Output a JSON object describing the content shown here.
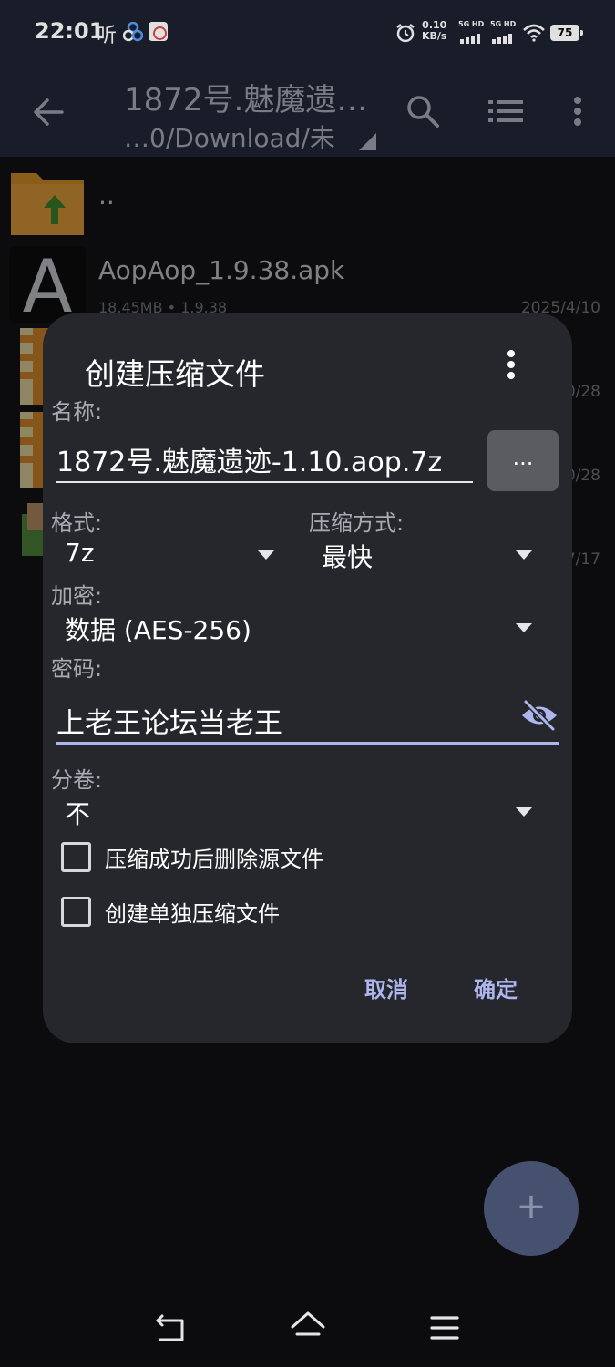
{
  "status_bar": {
    "time": "22:01",
    "listen": "听",
    "net_speed_value": "0.10",
    "net_speed_unit": "KB/s",
    "sim1_label": "5G HD",
    "sim2_label": "5G HD",
    "battery": "75"
  },
  "toolbar": {
    "title": "1872号.魅魔遗…",
    "path": "…0/Download/未"
  },
  "files": [
    {
      "name": "..",
      "meta": "",
      "date": ""
    },
    {
      "name": "AopAop_1.9.38.apk",
      "meta": "18.45MB  • 1.9.38",
      "date": "2025/4/10"
    },
    {
      "name": "",
      "meta": "",
      "date": "0/28"
    },
    {
      "name": "",
      "meta": "",
      "date": "0/28"
    },
    {
      "name": "",
      "meta": "",
      "date": "7/17"
    }
  ],
  "dialog": {
    "title": "创建压缩文件",
    "name_label": "名称:",
    "name_value": "1872号.魅魔遗迹-1.10.aop.7z",
    "browse_label": "...",
    "format_label": "格式:",
    "format_value": "7z",
    "method_label": "压缩方式:",
    "method_value": "最快",
    "encrypt_label": "加密:",
    "encrypt_value": "数据 (AES-256)",
    "password_label": "密码:",
    "password_value": "上老王论坛当老王",
    "split_label": "分卷:",
    "split_value": "不",
    "delete_source_label": "压缩成功后删除源文件",
    "delete_source_checked": false,
    "separate_label": "创建单独压缩文件",
    "separate_checked": false,
    "cancel_label": "取消",
    "ok_label": "确定"
  },
  "fab": {
    "symbol": "+"
  },
  "colors": {
    "dialog_bg": "#26272c",
    "accent": "#aeb6ee",
    "toolbar_bg": "#1d2230",
    "folder_orange": "#e0962c",
    "fab_bg": "#465170"
  }
}
